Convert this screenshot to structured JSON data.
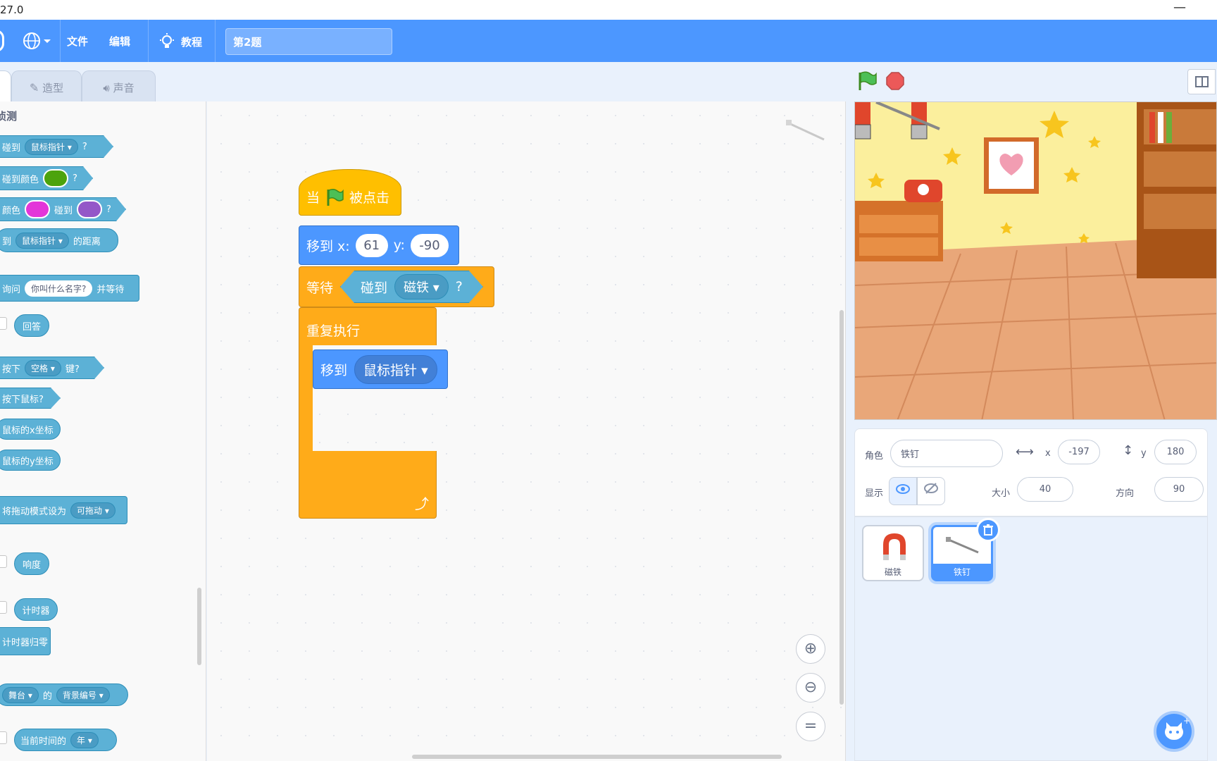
{
  "window": {
    "version_fragment": "27.0",
    "minimize_glyph": "—"
  },
  "menu": {
    "file": "文件",
    "edit": "编辑",
    "tutorials": "教程",
    "project_title": "第2题"
  },
  "tabs": {
    "costumes": "造型",
    "sounds": "声音"
  },
  "palette": {
    "category": "侦测",
    "touching": {
      "prefix": "碰到",
      "option": "鼠标指针",
      "suffix": "?"
    },
    "touching_color": {
      "prefix": "碰到颜色",
      "suffix": "?",
      "color": "#4ca30d"
    },
    "color_touching": {
      "prefix": "颜色",
      "mid": "碰到",
      "suffix": "?",
      "color1": "#e335d9",
      "color2": "#9457c8"
    },
    "distance": {
      "prefix": "到",
      "option": "鼠标指针",
      "suffix": "的距离"
    },
    "ask": {
      "prefix": "询问",
      "input": "你叫什么名字?",
      "suffix": "并等待"
    },
    "answer": "回答",
    "key_pressed": {
      "prefix": "按下",
      "option": "空格",
      "suffix": "键?"
    },
    "mouse_down": "按下鼠标?",
    "mouse_x": "鼠标的x坐标",
    "mouse_y": "鼠标的y坐标",
    "drag_mode": {
      "prefix": "将拖动模式设为",
      "option": "可拖动"
    },
    "loudness": "响度",
    "timer": "计时器",
    "reset_timer": "计时器归零",
    "of": {
      "option1": "舞台",
      "mid": "的",
      "option2": "背景编号"
    },
    "current": {
      "prefix": "当前时间的",
      "option": "年"
    }
  },
  "script": {
    "hat": {
      "when": "当",
      "clicked": "被点击"
    },
    "goto_xy": {
      "label": "移到 x:",
      "x": "61",
      "ylabel": "y:",
      "y": "-90"
    },
    "wait_until": {
      "label": "等待",
      "touching": "碰到",
      "option": "磁铁",
      "q": "?"
    },
    "forever": {
      "label": "重复执行"
    },
    "goto": {
      "label": "移到",
      "option": "鼠标指针"
    }
  },
  "sprite_info": {
    "sprite_label": "角色",
    "sprite_name": "铁钉",
    "x_label": "x",
    "x": "-197",
    "y_label": "y",
    "y": "180",
    "show_label": "显示",
    "size_label": "大小",
    "size": "40",
    "direction_label": "方向",
    "direction": "90"
  },
  "sprites": [
    {
      "name": "磁铁",
      "selected": false
    },
    {
      "name": "铁钉",
      "selected": true
    }
  ],
  "colors": {
    "menu_blue": "#4c97ff",
    "events": "#ffbf00",
    "control": "#ffab19",
    "motion": "#4c97ff",
    "sensing": "#5cb1d6"
  }
}
